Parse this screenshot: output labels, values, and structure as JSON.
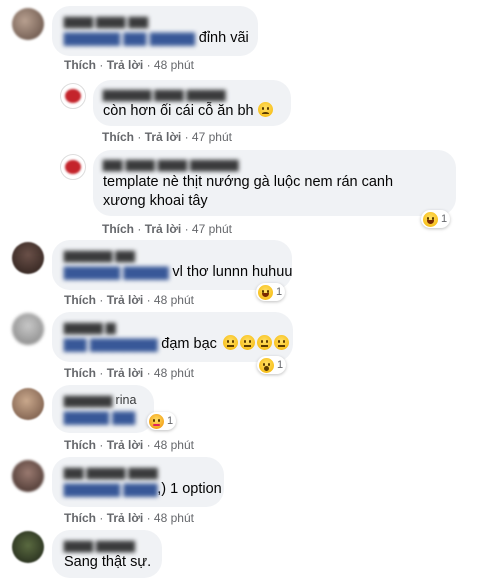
{
  "actions": {
    "like": "Thích",
    "reply": "Trả lời",
    "separator": "·"
  },
  "comments": [
    {
      "text": "đỉnh vãi",
      "time": "48 phút"
    },
    {
      "text": "còn hơn ối cái cỗ ăn bh",
      "time": "47 phút"
    },
    {
      "text_line1": "template nè thịt nướng gà luộc nem rán canh",
      "text_line2": "xương khoai tây",
      "time": "47 phút",
      "reaction_count": "1"
    },
    {
      "text": "vl thơ lunnn huhuu",
      "time": "48 phút",
      "reaction_count": "1"
    },
    {
      "text": "đạm bạc",
      "time": "48 phút",
      "reaction_count": "1"
    },
    {
      "name_suffix": "rina",
      "time": "48 phút",
      "reaction_count": "1"
    },
    {
      "text": ",) 1 option",
      "time": "48 phút"
    },
    {
      "text": "Sang thật sự."
    }
  ],
  "colors": {
    "bubble": "#f0f2f5",
    "meta": "#65676b",
    "text": "#050505"
  }
}
